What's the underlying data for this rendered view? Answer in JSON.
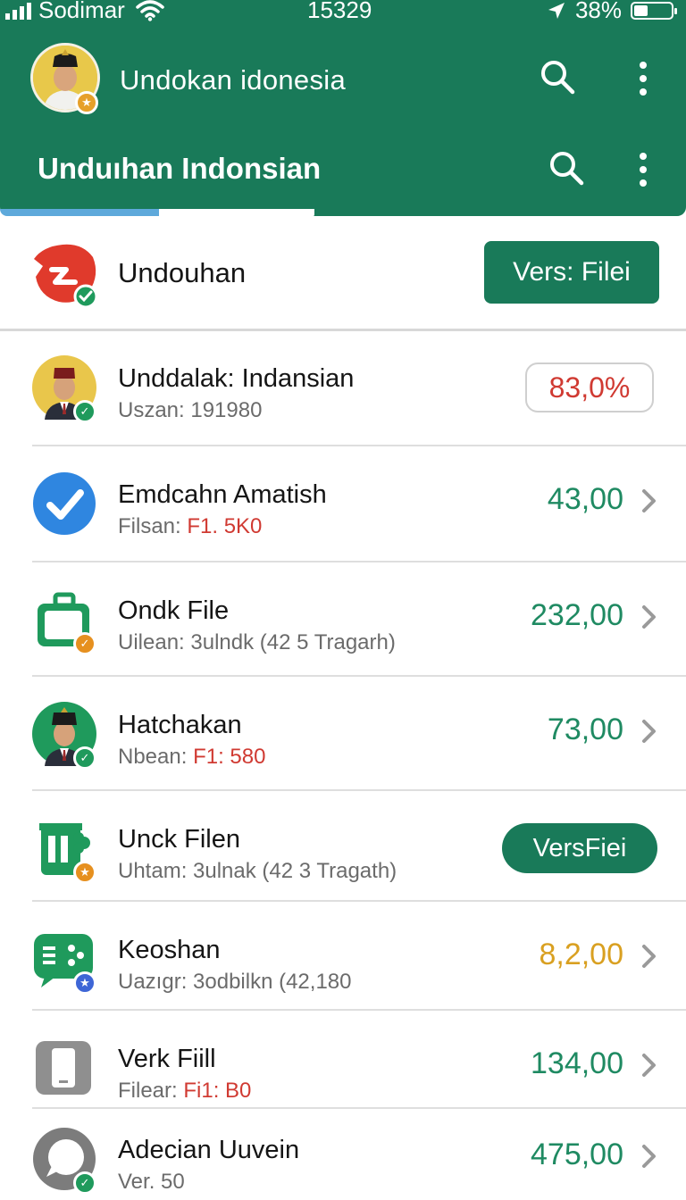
{
  "status_bar": {
    "carrier": "Sodimar",
    "time": "15329",
    "battery": "38%",
    "battery_level": 0.38
  },
  "header": {
    "app_title": "Undokan idonesia",
    "section_title": "Unduıhan Indonsian"
  },
  "top_row": {
    "title": "Undouhan",
    "button_label": "Vers: Filei"
  },
  "items": [
    {
      "title": "Unddalak: Indansian",
      "sub": "Uszan: 191980",
      "sub_red": "",
      "value": "83,0%"
    },
    {
      "title": "Emdcahn Amatish",
      "sub": "Filsan: ",
      "sub_red": "F1. 5K0",
      "value": "43,00"
    },
    {
      "title": "Ondk File",
      "sub": "Uilean: 3ulndk  (42 5 Tragarh)",
      "sub_red": "",
      "value": "232,00"
    },
    {
      "title": "Hatchakan",
      "sub": "Nbean: ",
      "sub_red": "F1: 580",
      "value": "73,00"
    },
    {
      "title": "Unck Filen",
      "sub": "Uhtam: 3ulnak  (42 3 Tragath)",
      "sub_red": "",
      "button": "VersFiei"
    },
    {
      "title": "Keoshan",
      "sub": "Uazıgr: 3odbilkn (42,180",
      "sub_red": "",
      "value": "8,2,00"
    },
    {
      "title": "Verk Fiill",
      "sub": "Filear: ",
      "sub_red": "Fi1: B0",
      "value": "134,00"
    },
    {
      "title": "Adecian Uuvein",
      "sub": "Ver. 50",
      "sub_red": "",
      "value": "475,00"
    }
  ],
  "colors": {
    "brand_green": "#197a59",
    "value_green": "#1f8a62",
    "value_red": "#d03a32",
    "value_amber": "#d9a021",
    "tab_indicator": "#5ea9db"
  }
}
